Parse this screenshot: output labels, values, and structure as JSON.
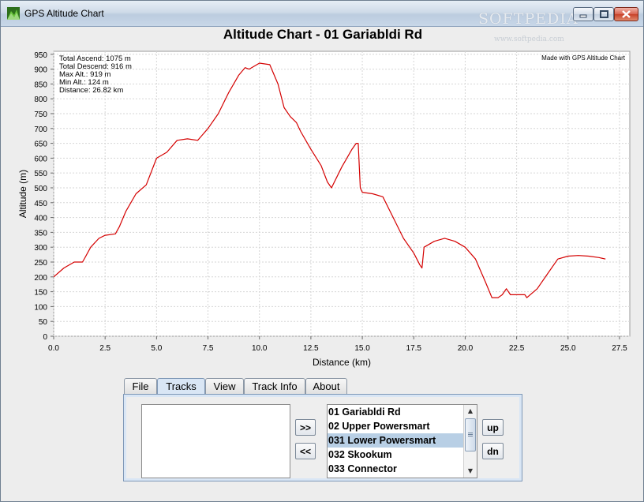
{
  "window": {
    "title": "GPS Altitude Chart",
    "watermark": "SOFTPEDIA",
    "watermark_sub": "www.softpedia.com"
  },
  "chart_data": {
    "type": "line",
    "title": "Altitude Chart - 01 Gariabldi Rd",
    "xlabel": "Distance (km)",
    "ylabel": "Altitude (m)",
    "xlim": [
      0,
      28.0
    ],
    "ylim": [
      0,
      960
    ],
    "x_ticks": [
      "0.0",
      "2.5",
      "5.0",
      "7.5",
      "10.0",
      "12.5",
      "15.0",
      "17.5",
      "20.0",
      "22.5",
      "25.0",
      "27.5"
    ],
    "y_ticks": [
      "0",
      "50",
      "100",
      "150",
      "200",
      "250",
      "300",
      "350",
      "400",
      "450",
      "500",
      "550",
      "600",
      "650",
      "700",
      "750",
      "800",
      "850",
      "900",
      "950"
    ],
    "grid": true,
    "line_color": "#d40000",
    "credit": "Made with GPS Altitude Chart",
    "stats": [
      "Total Ascend: 1075 m",
      "Total Descend: 916 m",
      "Max Alt.: 919 m",
      "Min Alt.: 124 m",
      "Distance: 26.82 km"
    ],
    "series": [
      {
        "x": [
          0,
          0.5,
          1.0,
          1.4,
          1.5,
          1.8,
          2.2,
          2.5,
          3.0,
          3.2,
          3.5,
          4.0,
          4.5,
          5.0,
          5.5,
          6.0,
          6.5,
          7.0,
          7.5,
          8.0,
          8.5,
          9.0,
          9.3,
          9.5,
          10.0,
          10.5,
          10.9,
          11.2,
          11.5,
          11.8,
          12.0,
          12.5,
          13.0,
          13.3,
          13.5,
          14.0,
          14.5,
          14.7,
          14.8,
          14.9,
          15.0,
          15.5,
          16.0,
          16.5,
          17.0,
          17.5,
          17.8,
          17.9,
          18.0,
          18.5,
          19.0,
          19.5,
          20.0,
          20.5,
          21.0,
          21.3,
          21.6,
          21.8,
          22.0,
          22.2,
          22.5,
          22.9,
          23.0,
          23.5,
          24.0,
          24.5,
          25.0,
          25.5,
          26.0,
          26.5,
          26.82
        ],
        "y": [
          200,
          230,
          250,
          250,
          262,
          300,
          330,
          340,
          345,
          370,
          420,
          480,
          510,
          600,
          620,
          660,
          665,
          660,
          700,
          750,
          820,
          880,
          905,
          900,
          920,
          915,
          850,
          770,
          740,
          720,
          690,
          630,
          575,
          520,
          500,
          570,
          630,
          650,
          650,
          500,
          485,
          480,
          470,
          400,
          330,
          280,
          240,
          230,
          300,
          320,
          330,
          320,
          300,
          260,
          180,
          130,
          130,
          140,
          160,
          140,
          140,
          140,
          130,
          160,
          210,
          260,
          270,
          272,
          270,
          265,
          260
        ]
      }
    ]
  },
  "tabs": [
    "File",
    "Tracks",
    "View",
    "Track Info",
    "About"
  ],
  "selected_tab": "Tracks",
  "buttons": {
    "add": ">>",
    "remove": "<<",
    "up": "up",
    "down": "dn"
  },
  "tracks": [
    "01 Gariabldi Rd",
    "02 Upper Powersmart",
    "031 Lower Powersmart",
    "032 Skookum",
    "033 Connector"
  ],
  "selected_track": "031 Lower Powersmart"
}
